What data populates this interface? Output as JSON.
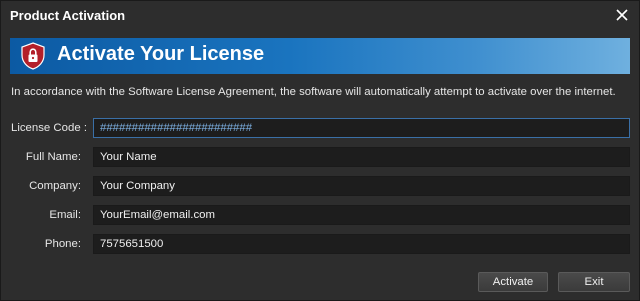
{
  "window": {
    "title": "Product Activation"
  },
  "banner": {
    "title": "Activate Your License",
    "icon": "shield-lock-icon"
  },
  "intro_text": "In accordance with the Software License Agreement, the software will automatically attempt to activate over the internet.",
  "form": {
    "license_code": {
      "label": "License Code :",
      "value": "########################"
    },
    "full_name": {
      "label": "Full Name:",
      "value": "Your Name"
    },
    "company": {
      "label": "Company:",
      "value": "Your Company"
    },
    "email": {
      "label": "Email:",
      "value": "YourEmail@email.com"
    },
    "phone": {
      "label": "Phone:",
      "value": "7575651500"
    }
  },
  "buttons": {
    "activate": "Activate",
    "exit": "Exit"
  },
  "colors": {
    "banner_start": "#0c5aa3",
    "banner_end": "#6fb0df",
    "shield": "#b3202a",
    "background": "#2d2d2d"
  }
}
